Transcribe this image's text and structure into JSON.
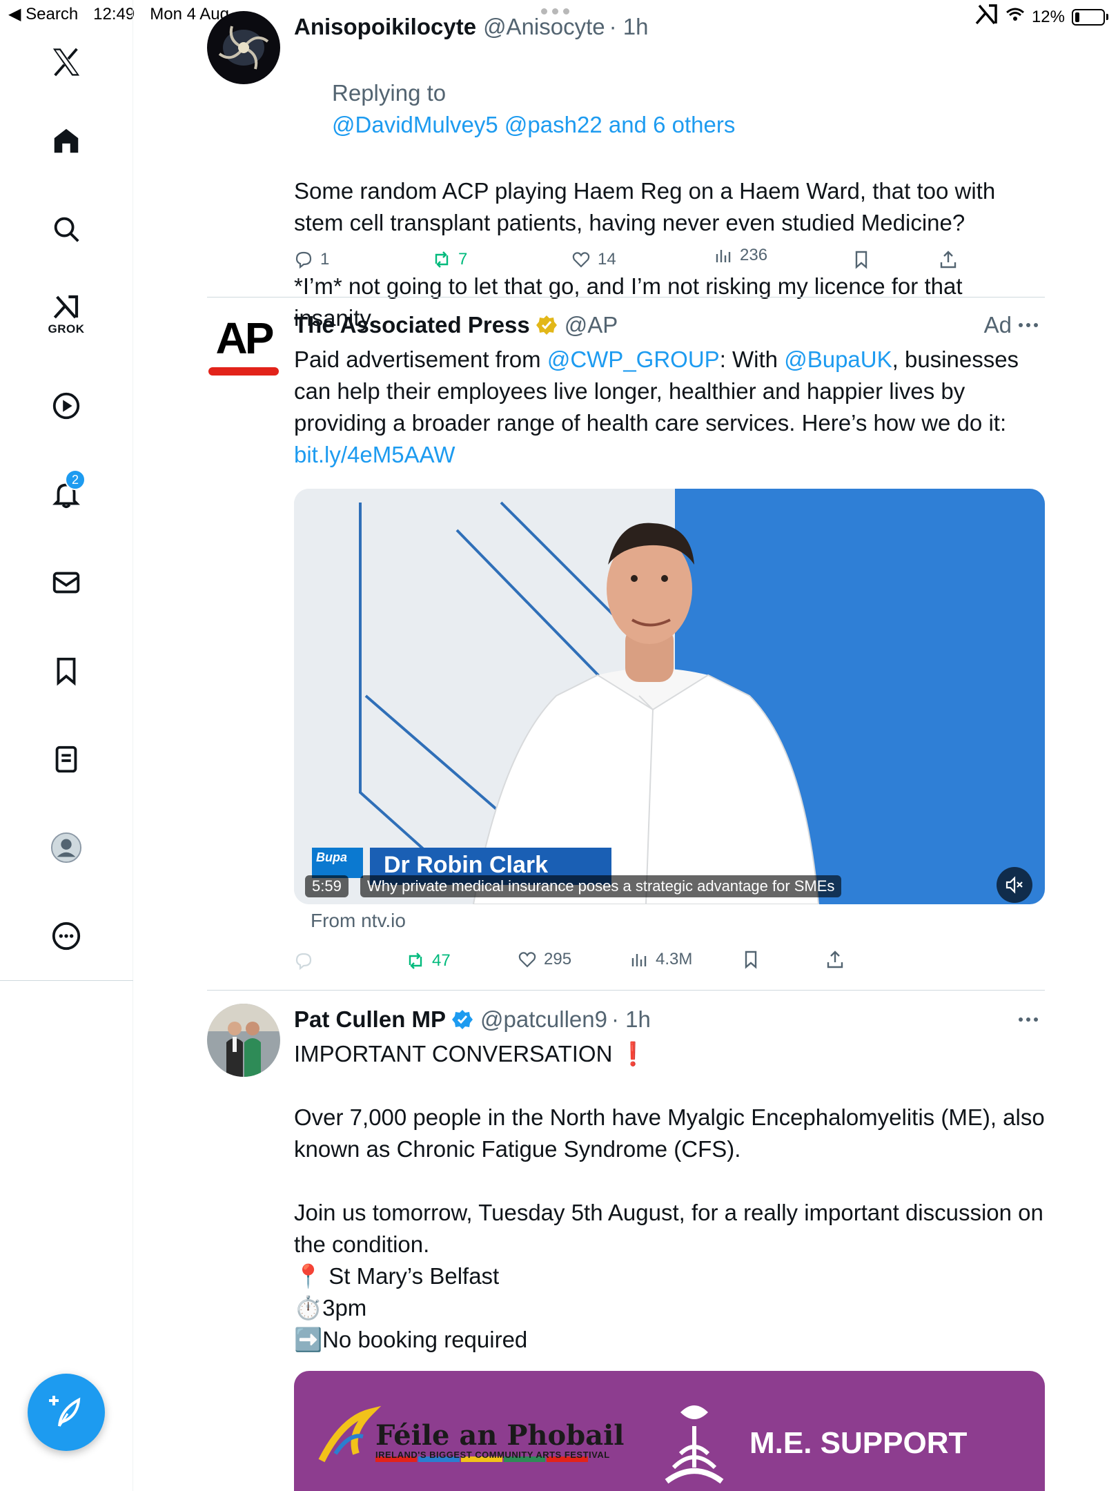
{
  "status_bar": {
    "back_label": "◀ Search",
    "time": "12:49",
    "date": "Mon 4 Aug",
    "battery": "12%"
  },
  "sidebar": {
    "grok_label": "GROK",
    "notifications_count": "2"
  },
  "posts": [
    {
      "name": "Anisopoikilocyte",
      "handle": "@Anisocyte",
      "time": "· 1h",
      "replying_prefix": "Replying to",
      "replying_to": "@DavidMulvey5 @pash22 and 6 others",
      "text": "Some random ACP playing Haem Reg on a Haem Ward, that too with stem cell transplant patients, having never even studied Medicine?\n\n*I’m* not going to let that go, and I’m not risking my licence for that insanity.",
      "replies": "1",
      "reposts": "7",
      "likes": "14",
      "views": "236"
    },
    {
      "name": "The Associated Press",
      "handle": "@AP",
      "ad_label": "Ad",
      "text_prefix": "Paid advertisement from ",
      "mention1": "@CWP_GROUP",
      "text_mid": ": With ",
      "mention2": "@BupaUK",
      "text_rest": ", businesses can help their employees live longer, healthier and happier lives by providing a broader range of health care services. Here’s how we do it: ",
      "link": "bit.ly/4eM5AAW",
      "video": {
        "brand": "Bupa",
        "speaker": "Dr Robin Clark",
        "duration": "5:59",
        "title": "Why private medical insurance poses a strategic advantage for SMEs"
      },
      "source": "From ntv.io",
      "reposts": "47",
      "likes": "295",
      "views": "4.3M"
    },
    {
      "name": "Pat Cullen MP",
      "handle": "@patcullen9",
      "time": "· 1h",
      "text": "IMPORTANT CONVERSATION ❗\n\nOver 7,000 people in the North have Myalgic Encephalomyelitis (ME), also known as Chronic Fatigue Syndrome (CFS).\n\nJoin us tomorrow, Tuesday 5th August, for a really important discussion on the condition.\n📍 St Mary’s Belfast\n⏱️3pm\n➡️No booking required",
      "image": {
        "left_title": "Féile an Phobail",
        "left_subtitle": "IRELAND'S BIGGEST COMMUNITY ARTS FESTIVAL",
        "right_title": "M.E. SUPPORT"
      }
    }
  ],
  "colors": {
    "accent": "#1d9bf0",
    "repost_green": "#00ba7c",
    "muted": "#536471",
    "ap_red": "#e2231a",
    "card_purple": "#8d3d8f"
  }
}
